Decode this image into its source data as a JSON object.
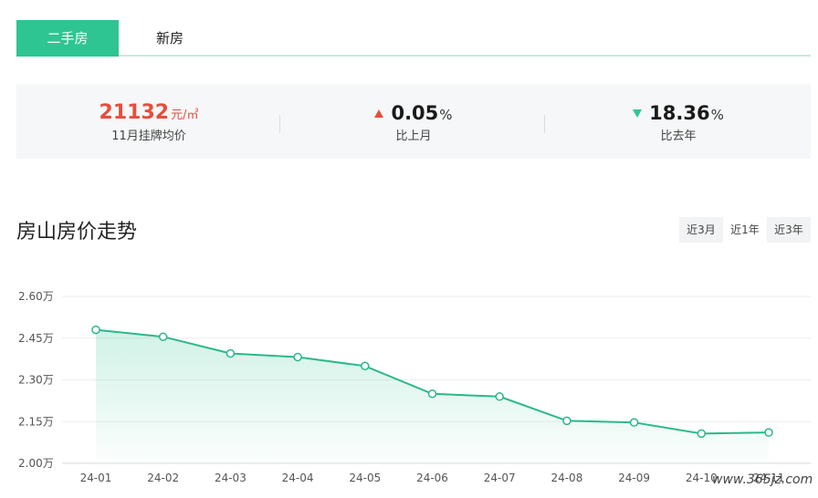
{
  "tabs": [
    {
      "label": "二手房",
      "active": true
    },
    {
      "label": "新房",
      "active": false
    }
  ],
  "stats": {
    "avg_price": {
      "value": "21132",
      "unit": "元/㎡",
      "label": "11月挂牌均价"
    },
    "mom": {
      "direction": "up",
      "value": "0.05",
      "unit": "%",
      "label": "比上月"
    },
    "yoy": {
      "direction": "down",
      "value": "18.36",
      "unit": "%",
      "label": "比去年"
    }
  },
  "section_title": "房山房价走势",
  "range_buttons": [
    "近3月",
    "近1年",
    "近3年"
  ],
  "watermark": "www.365jz.com",
  "colors": {
    "accent": "#2ec592",
    "price": "#e64e3d",
    "line": "#2bb888"
  },
  "chart_data": {
    "type": "area",
    "x": [
      "24-01",
      "24-02",
      "24-03",
      "24-04",
      "24-05",
      "24-06",
      "24-07",
      "24-08",
      "24-09",
      "24-10",
      "24-11"
    ],
    "values": [
      2.48,
      2.455,
      2.395,
      2.382,
      2.35,
      2.25,
      2.24,
      2.153,
      2.147,
      2.107,
      2.111
    ],
    "y_ticks": [
      "2.60万",
      "2.45万",
      "2.30万",
      "2.15万",
      "2.00万"
    ],
    "y_tick_values": [
      2.6,
      2.45,
      2.3,
      2.15,
      2.0
    ],
    "ylim": [
      2.0,
      2.6
    ],
    "grid": true,
    "legend": "none"
  }
}
